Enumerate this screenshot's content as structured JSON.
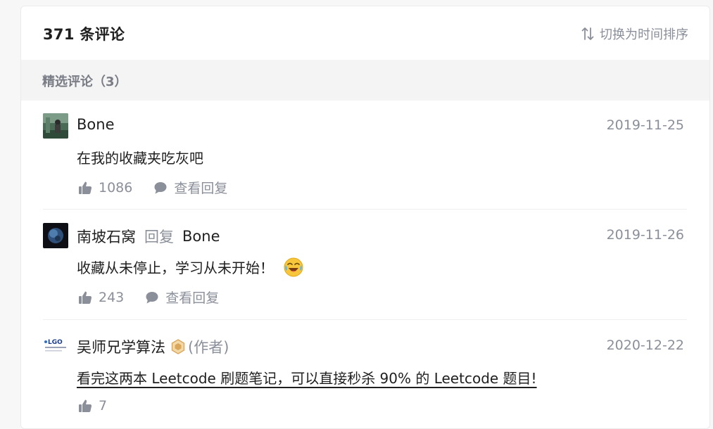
{
  "header": {
    "title": "371 条评论",
    "sort_label": "切换为时间排序"
  },
  "section": {
    "title": "精选评论（3）"
  },
  "comments": [
    {
      "user": "Bone",
      "date": "2019-11-25",
      "content": "在我的收藏夹吃灰吧",
      "likes": "1086",
      "view_replies": "查看回复"
    },
    {
      "user": "南坡石窝",
      "reply_word": "回复",
      "reply_to": "Bone",
      "date": "2019-11-26",
      "content": "收藏从未停止，学习从未开始！",
      "emoji": "laughing-crying-emoji",
      "likes": "243",
      "view_replies": "查看回复"
    },
    {
      "user": "吴师兄学算法",
      "author_tag": "(作者)",
      "date": "2020-12-22",
      "content": "看完这两本 Leetcode 刷题笔记，可以直接秒杀 90% 的 Leetcode 题目!",
      "likes": "7",
      "avatar_logo": "LGO"
    }
  ],
  "colors": {
    "text": "#1f1f1f",
    "muted": "#8a8f99",
    "section_bg": "#f4f4f5"
  }
}
